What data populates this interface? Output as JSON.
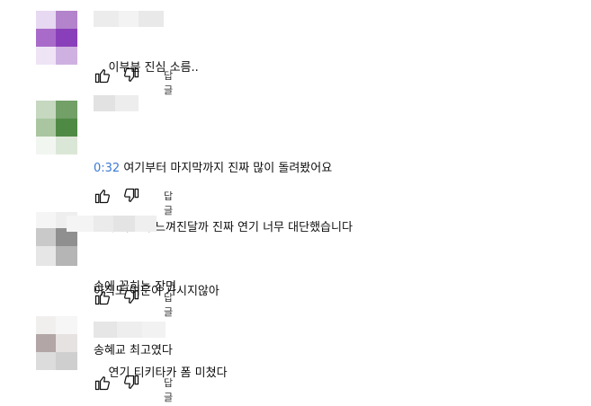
{
  "comments": [
    {
      "timestamp": "",
      "lines": [
        "이부분 진심 소름.."
      ],
      "reply_label": "답글"
    },
    {
      "timestamp": "0:32",
      "lines": [
        "여기부터 마지막까지 진짜 많이 돌려봤어요",
        "뭔가 회열이 느껴진달까 진짜 연기 너무 대단했습니다",
        "손에 꼽히는 장면"
      ],
      "reply_label": "답글"
    },
    {
      "timestamp": "",
      "lines": [
        "아직도 여운이 가시지않아",
        "송혜교 최고였다"
      ],
      "reply_label": "답글"
    },
    {
      "timestamp": "",
      "lines": [
        "연기 티키타카 폼 미쳤다"
      ],
      "reply_label": "답글"
    }
  ],
  "icons": {
    "like": "thumbs-up-icon",
    "dislike": "thumbs-down-icon"
  },
  "colors": {
    "timestamp": "#3a7bd5"
  }
}
